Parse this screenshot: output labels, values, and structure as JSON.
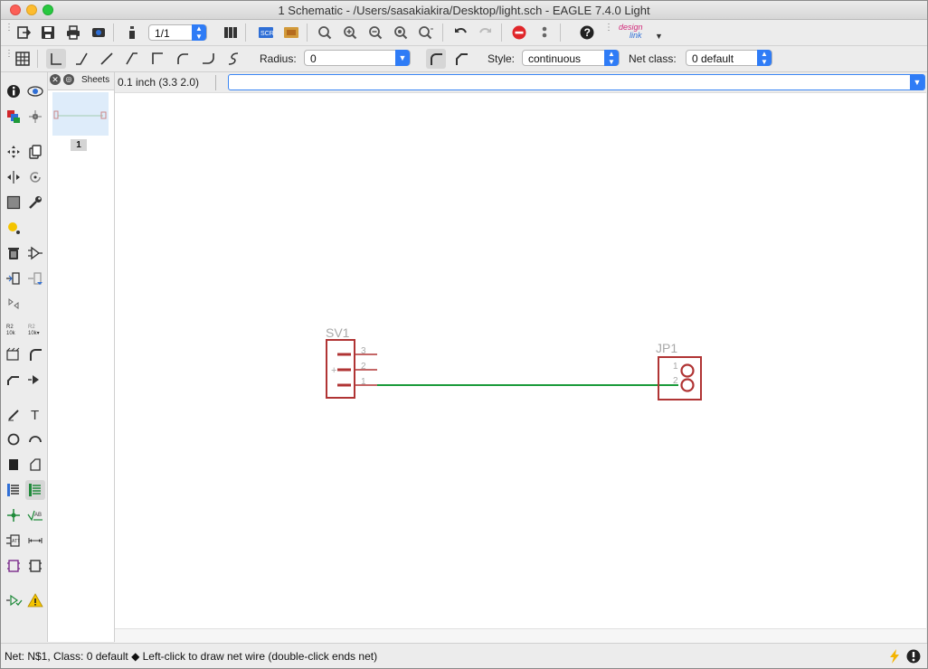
{
  "window": {
    "title": "1 Schematic - /Users/sasakiakira/Desktop/light.sch - EAGLE 7.4.0 Light"
  },
  "toolbar": {
    "sheet_select": "1/1",
    "designlink_top": "design",
    "designlink_bottom": "link"
  },
  "params": {
    "radius_label": "Radius:",
    "radius_value": "0",
    "style_label": "Style:",
    "style_value": "continuous",
    "netclass_label": "Net class:",
    "netclass_value": "0 default"
  },
  "sheets": {
    "title": "Sheets",
    "page_label": "1"
  },
  "command": {
    "coordinates": "0.1 inch (3.3 2.0)",
    "input_value": ""
  },
  "schematic": {
    "sv1": {
      "name": "SV1",
      "pins": [
        "3",
        "2",
        "1"
      ],
      "polarity": "+"
    },
    "jp1": {
      "name": "JP1",
      "pins": [
        "1",
        "2"
      ]
    },
    "net_color": "#1a9a3a",
    "symbol_color": "#b03434",
    "label_color": "#a8a8a8"
  },
  "status": {
    "text": "Net: N$1, Class: 0 default  ◆  Left-click to draw net wire (double-click ends net)"
  }
}
